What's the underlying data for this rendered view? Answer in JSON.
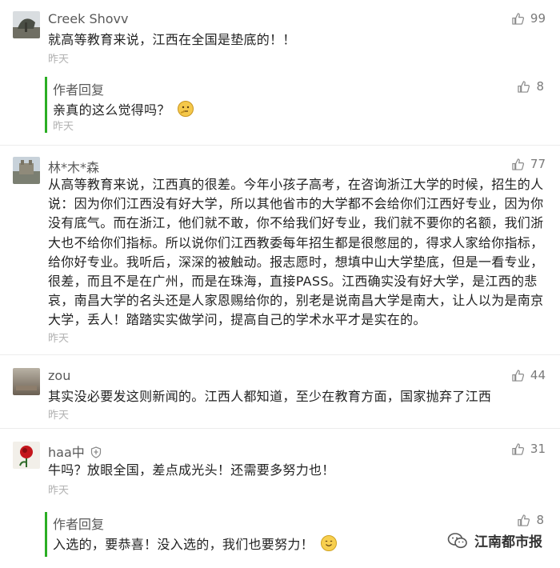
{
  "comments": [
    {
      "user": "Creek Shovv",
      "text": "就高等教育来说，江西在全国是垫底的！！",
      "time": "昨天",
      "likes": "99",
      "reply": {
        "author": "作者回复",
        "text": "亲真的这么觉得吗？",
        "time": "昨天",
        "likes": "8"
      }
    },
    {
      "user": "林*木*森",
      "lines": [
        "从高等教育来说，江西真的很差。今年小孩子高考，在咨询浙江大学的时候，招生的人",
        "说：因为你们江西没有好大学，所以其他省市的大学都不会给你们江西好专业，因为你",
        "没有底气。而在浙江，他们就不敢，你不给我们好专业，我们就不要你的名额，我们浙",
        "大也不给你们指标。所以说你们江西教委每年招生都是很憋屈的，得求人家给你指标，",
        "给你好专业。我听后，深深的被触动。报志愿时，想填中山大学垫底，但是一看专业，",
        "很差，而且不是在广州，而是在珠海，直接PASS。江西确实没有好大学，是江西的悲",
        "哀，南昌大学的名头还是人家恩赐给你的，别老是说南昌大学是南大，让人以为是南京",
        "大学，丢人！踏踏实实做学问，提高自己的学术水平才是实在的。"
      ],
      "time": "昨天",
      "likes": "77"
    },
    {
      "user": "zou",
      "text": "其实没必要发这则新闻的。江西人都知道，至少在教育方面，国家抛弃了江西",
      "time": "昨天",
      "likes": "44"
    },
    {
      "user": "haa中",
      "text": "牛吗？放眼全国，差点成光头！还需要多努力也！",
      "time": "昨天",
      "likes": "31",
      "reply": {
        "author": "作者回复",
        "text": "入选的，要恭喜！没入选的，我们也要努力！",
        "likes": "8"
      }
    }
  ],
  "watermark": "江南都市报",
  "colors": {
    "accent_green": "#2bae24",
    "name_gray": "#5a5a5a",
    "time_gray": "#b2b2b2"
  },
  "icons": {
    "like": "thumbs-up-icon",
    "verified": "shield-icon",
    "emoji_thinking": "thinking-face-icon",
    "emoji_smile": "smile-face-icon"
  }
}
